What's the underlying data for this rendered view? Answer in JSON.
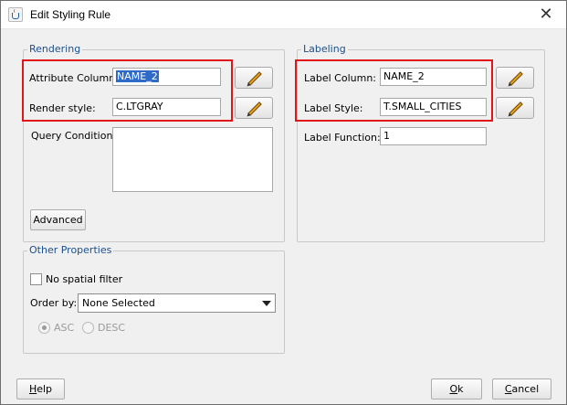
{
  "window": {
    "title": "Edit Styling Rule",
    "close_glyph": "✕",
    "icon": "java-cup-icon"
  },
  "rendering": {
    "legend": "Rendering",
    "attribute_columns_label": "Attribute Columns",
    "attribute_columns_value": "NAME_2",
    "render_style_label": "Render style:",
    "render_style_value": "C.LTGRAY",
    "query_condition_label": "Query Condition:",
    "query_condition_value": "",
    "advanced_button": "Advanced"
  },
  "labeling": {
    "legend": "Labeling",
    "label_column_label": "Label Column:",
    "label_column_value": "NAME_2",
    "label_style_label": "Label Style:",
    "label_style_value": "T.SMALL_CITIES",
    "label_function_label": "Label Function:",
    "label_function_value": "1"
  },
  "other_properties": {
    "legend": "Other Properties",
    "no_spatial_filter_label": "No spatial filter",
    "no_spatial_filter_checked": false,
    "order_by_label": "Order by:",
    "order_by_value": "None Selected",
    "asc_label": "ASC",
    "desc_label": "DESC"
  },
  "footer": {
    "help_underlined": "H",
    "help_rest": "elp",
    "ok_underlined": "O",
    "ok_rest": "k",
    "cancel_underlined": "C",
    "cancel_rest": "ancel"
  },
  "colors": {
    "highlight": "#e0161b",
    "legend_text": "#1a4f8f",
    "selection": "#2e6bc9"
  }
}
